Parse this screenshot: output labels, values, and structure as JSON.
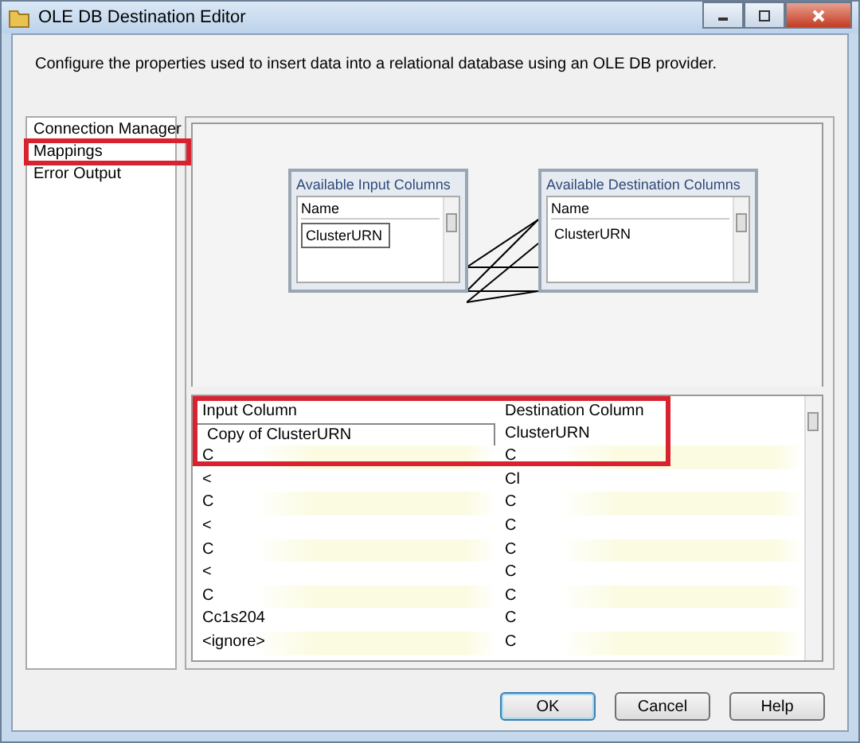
{
  "window": {
    "title": "OLE DB Destination Editor"
  },
  "description": "Configure the properties used to insert data into a relational database using an OLE DB provider.",
  "nav": [
    {
      "label": "Connection Manager",
      "highlighted": false
    },
    {
      "label": "Mappings",
      "highlighted": true
    },
    {
      "label": "Error Output",
      "highlighted": false
    }
  ],
  "input_columns": {
    "title": "Available Input Columns",
    "header": "Name",
    "items": [
      "ClusterURN"
    ]
  },
  "destination_columns": {
    "title": "Available Destination Columns",
    "header": "Name",
    "items": [
      "ClusterURN"
    ]
  },
  "mappings": {
    "highlighted": true,
    "columns": [
      "Input Column",
      "Destination Column"
    ],
    "rows": [
      [
        "Copy of ClusterURN",
        "ClusterURN"
      ],
      [
        "C",
        "C"
      ],
      [
        "<",
        "Cl"
      ],
      [
        "C",
        "C"
      ],
      [
        "<",
        "C"
      ],
      [
        "C",
        "C"
      ],
      [
        "<",
        "C"
      ],
      [
        "C",
        "C"
      ],
      [
        "Cc1s204",
        "C"
      ],
      [
        "<ignore>",
        "C"
      ]
    ]
  },
  "buttons": [
    "OK",
    "Cancel",
    "Help"
  ]
}
